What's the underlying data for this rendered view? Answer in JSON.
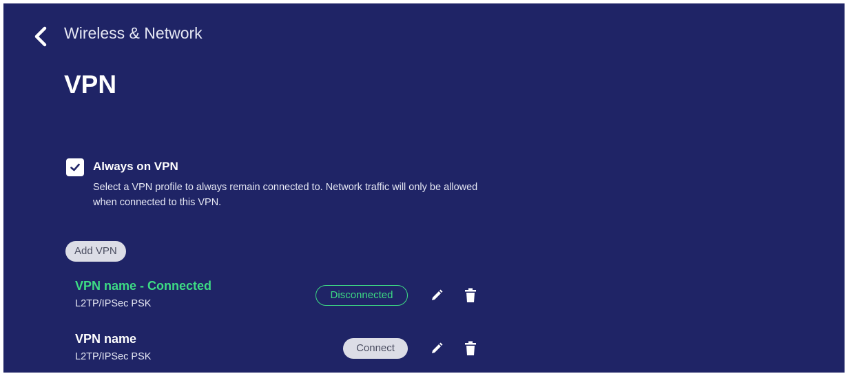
{
  "header": {
    "back_icon": "chevron-left-icon",
    "breadcrumb": "Wireless & Network",
    "title": "VPN"
  },
  "always_on": {
    "checked": true,
    "label": "Always on VPN",
    "description": "Select a VPN profile to always remain connected to. Network traffic will only be allowed when connected to this VPN."
  },
  "add_vpn_label": "Add VPN",
  "vpn_list": [
    {
      "name": "VPN name - Connected",
      "type": "L2TP/IPSec PSK",
      "action_label": "Disconnected",
      "connected": true
    },
    {
      "name": "VPN name",
      "type": "L2TP/IPSec PSK",
      "action_label": "Connect",
      "connected": false
    }
  ],
  "icons": {
    "edit": "pencil-icon",
    "delete": "trash-icon"
  },
  "colors": {
    "background": "#1f2466",
    "connected_green": "#3ddc84",
    "button_gray": "#dcdde6"
  }
}
